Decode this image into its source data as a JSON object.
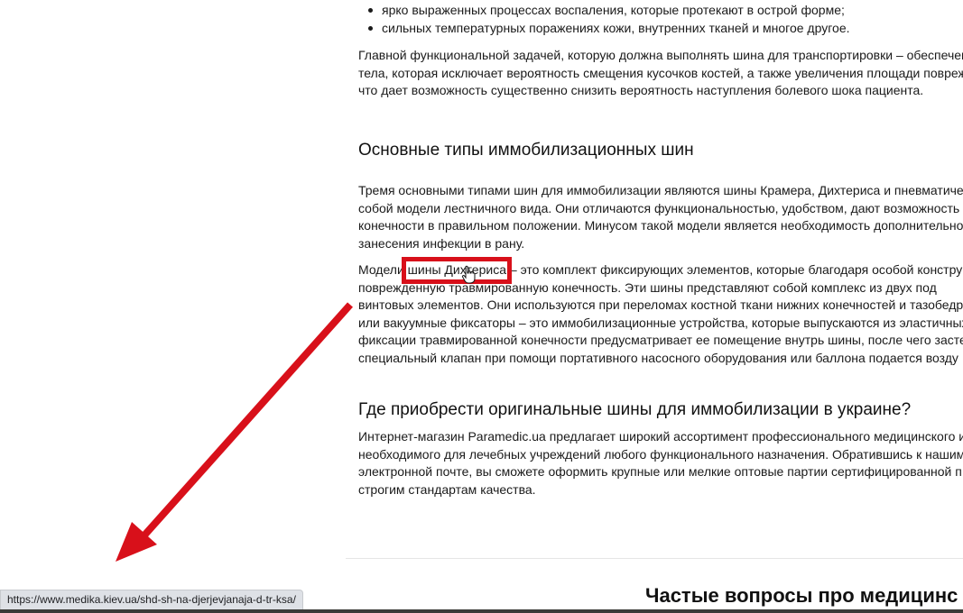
{
  "article": {
    "bullets": [
      "ярко выраженных процессах воспаления, которые протекают в острой форме;",
      "сильных температурных поражениях кожи, внутренних тканей и многое другое."
    ],
    "para_intro": [
      "Главной функциональной задачей, которую должна выполнять шина для транспортировки – обеспечен",
      "тела, которая исключает вероятность смещения кусочков костей, а также увеличения площади поврежд",
      "что дает возможность существенно снизить вероятность наступления болевого шока пациента."
    ],
    "heading_types": "Основные типы иммобилизационных шин",
    "para_types": [
      "Тремя основными типами шин для иммобилизации являются шины Крамера, Дихтериса и пневматиче",
      "собой модели лестничного вида. Они отличаются функциональностью, удобством, дают возможность",
      "конечности в правильном положении. Минусом такой модели является необходимость дополнительно",
      "занесения инфекции в рану."
    ],
    "para_dichteris": {
      "line1_before": "Модели ",
      "link_text": "шины Дихтериса",
      "line1_after": " – это комплект фиксирующих элементов, которые благодаря особой констру",
      "lines": [
        "поврежденную травмированную конечность. Эти шины представляют собой комплекс из двух под",
        "винтовых элементов. Они используются при переломах костной ткани нижних конечностей и тазобедр",
        "или вакуумные фиксаторы – это иммобилизационные устройства, которые выпускаются из эластичных",
        "фиксации травмированной конечности предусматривает ее помещение внутрь шины, после чего засте",
        "специальный клапан при помощи портативного насосного оборудования или баллона подается возду"
      ]
    },
    "heading_buy": "Где приобрести оригинальные шины для иммобилизации в украине?",
    "para_buy": [
      "Интернет-магазин Paramedic.ua предлагает широкий ассортимент профессионального медицинского и",
      "необходимого для лечебных учреждений любого функционального назначения. Обратившись к нашим",
      "электронной почте, вы сможете оформить крупные или мелкие оптовые партии сертифицированной п",
      "строгим стандартам качества."
    ]
  },
  "faq": {
    "title": "Частые вопросы про медицинс"
  },
  "status_bar": {
    "url": "https://www.medika.kiev.ua/shd-sh-na-djerjevjanaja-d-tr-ksa/"
  },
  "colors": {
    "annotation_red": "#d8101a",
    "status_bg": "#dee1e6"
  },
  "icons": {
    "cursor": "hand-pointer-icon",
    "annotation": "red-arrow-icon"
  }
}
